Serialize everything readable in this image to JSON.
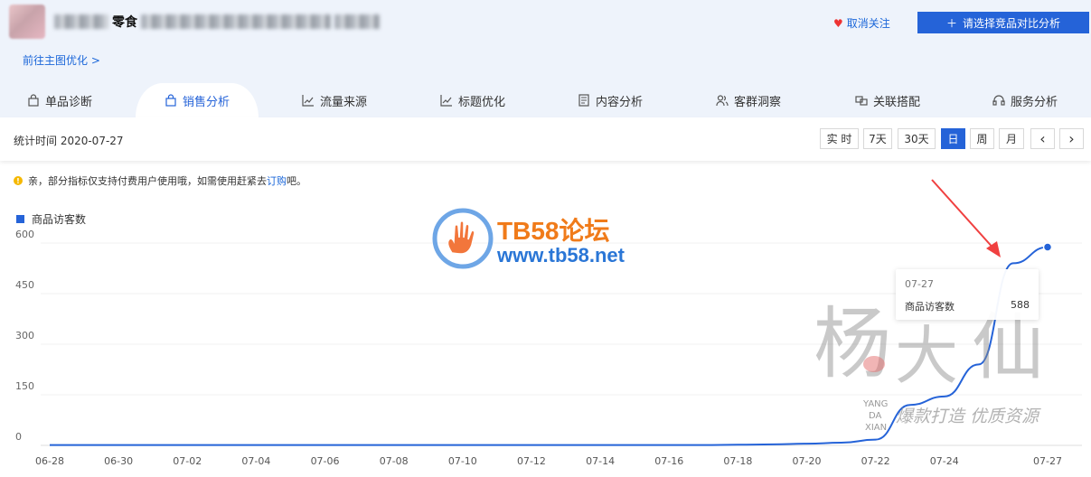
{
  "header": {
    "product_keyword": "零食",
    "unfollow_label": "取消关注",
    "compare_label": "请选择竞品对比分析",
    "goto_label": "前往主图优化 >"
  },
  "tabs": [
    {
      "label": "单品诊断"
    },
    {
      "label": "销售分析"
    },
    {
      "label": "流量来源"
    },
    {
      "label": "标题优化"
    },
    {
      "label": "内容分析"
    },
    {
      "label": "客群洞察"
    },
    {
      "label": "关联搭配"
    },
    {
      "label": "服务分析"
    }
  ],
  "toolbar": {
    "stat_time": "统计时间 2020-07-27",
    "ranges": [
      "实 时",
      "7天",
      "30天",
      "日",
      "周",
      "月"
    ],
    "prev": "‹",
    "next": "›"
  },
  "notice": {
    "text": "亲，部分指标仅支持付费用户使用哦，如需使用赶紧去",
    "link": "订购",
    "suffix": "吧。"
  },
  "watermark": {
    "brand": "TB58论坛",
    "url": "www.tb58.net",
    "yang": "杨大仙",
    "pinyin1": "YANG",
    "pinyin2": "DA",
    "pinyin3": "XIAN",
    "slogan": "爆款打造 优质资源"
  },
  "tooltip": {
    "date": "07-27",
    "name": "商品访客数",
    "value": "588"
  },
  "chart_data": {
    "type": "line",
    "legend": "商品访客数",
    "colors": {
      "series": "#2563d8"
    },
    "yticks": [
      "600",
      "450",
      "300",
      "150",
      "0"
    ],
    "ylim": [
      0,
      600
    ],
    "xticks": [
      "06-28",
      "06-30",
      "07-02",
      "07-04",
      "07-06",
      "07-08",
      "07-10",
      "07-12",
      "07-14",
      "07-16",
      "07-18",
      "07-20",
      "07-22",
      "07-24",
      "07-27"
    ],
    "series": [
      {
        "name": "商品访客数",
        "x": [
          "06-28",
          "06-29",
          "06-30",
          "07-01",
          "07-02",
          "07-03",
          "07-04",
          "07-05",
          "07-06",
          "07-07",
          "07-08",
          "07-09",
          "07-10",
          "07-11",
          "07-12",
          "07-13",
          "07-14",
          "07-15",
          "07-16",
          "07-17",
          "07-18",
          "07-19",
          "07-20",
          "07-21",
          "07-22",
          "07-23",
          "07-24",
          "07-25",
          "07-26",
          "07-27"
        ],
        "values": [
          1,
          1,
          1,
          1,
          1,
          1,
          1,
          1,
          1,
          1,
          1,
          1,
          1,
          1,
          1,
          1,
          1,
          1,
          1,
          1,
          2,
          3,
          5,
          8,
          17,
          120,
          145,
          240,
          540,
          588
        ]
      }
    ]
  }
}
